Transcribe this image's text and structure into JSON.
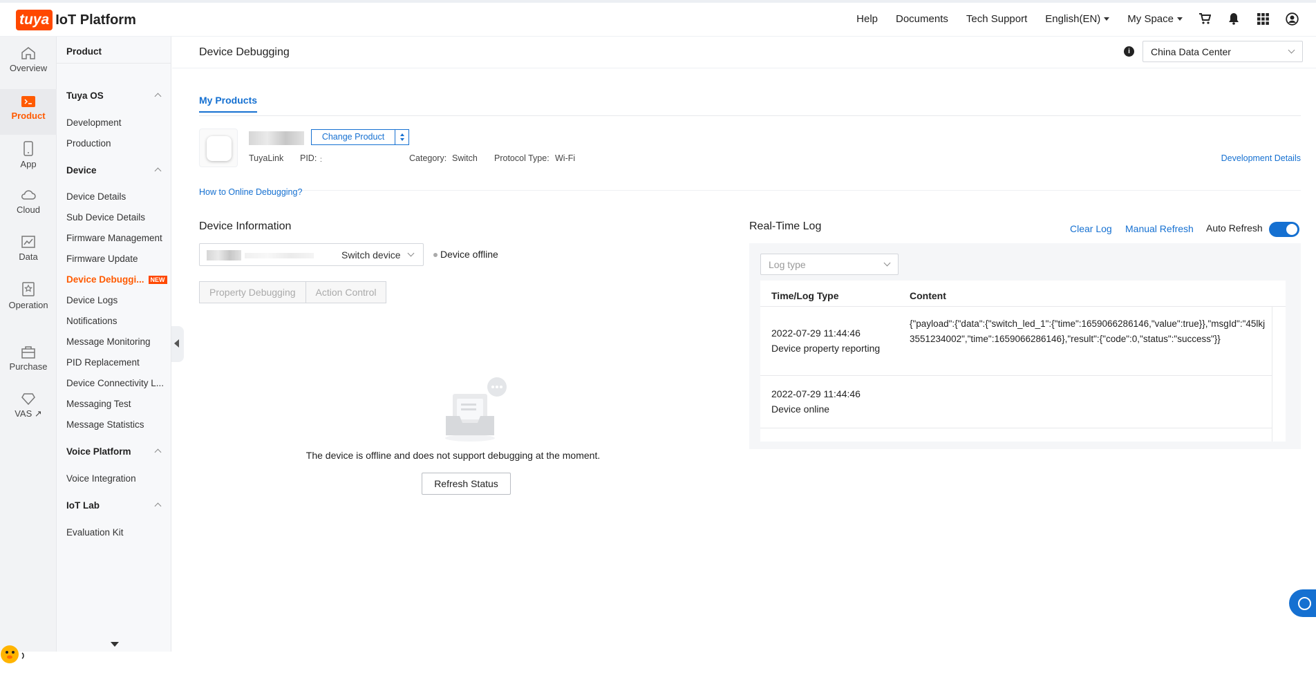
{
  "brand": {
    "logo_badge": "tuya",
    "logo_text": "IoT Platform"
  },
  "topnav": {
    "help": "Help",
    "documents": "Documents",
    "tech_support": "Tech Support",
    "language": "English(EN)",
    "my_space": "My Space"
  },
  "rail": {
    "items": [
      {
        "label": "Overview",
        "icon": "home-icon"
      },
      {
        "label": "Product",
        "icon": "terminal-icon"
      },
      {
        "label": "App",
        "icon": "phone-icon"
      },
      {
        "label": "Cloud",
        "icon": "cloud-icon"
      },
      {
        "label": "Data",
        "icon": "chart-icon"
      },
      {
        "label": "Operation",
        "icon": "badge-icon"
      },
      {
        "label": "Purchase",
        "icon": "bag-icon"
      },
      {
        "label": "VAS ↗",
        "icon": "diamond-icon"
      }
    ],
    "active_color": "#ff5a00"
  },
  "sidebar": {
    "title": "Product",
    "groups": {
      "tuya_os": "Tuya OS",
      "device": "Device",
      "voice": "Voice Platform",
      "iot_lab": "IoT Lab"
    },
    "items": {
      "development": "Development",
      "production": "Production",
      "device_details": "Device Details",
      "sub_device_details": "Sub Device Details",
      "firmware_management": "Firmware Management",
      "firmware_update": "Firmware Update",
      "device_debugging": "Device Debuggi...",
      "device_debugging_badge": "NEW",
      "device_logs": "Device Logs",
      "notifications": "Notifications",
      "message_monitoring": "Message Monitoring",
      "pid_replacement": "PID Replacement",
      "device_connectivity": "Device Connectivity L...",
      "messaging_test": "Messaging Test",
      "message_statistics": "Message Statistics",
      "voice_integration": "Voice Integration",
      "evaluation_kit": "Evaluation Kit"
    }
  },
  "page": {
    "title": "Device Debugging",
    "data_center": "China Data Center",
    "tab": "My Products",
    "product": {
      "change_button": "Change Product",
      "type": "TuyaLink",
      "pid_label": "PID:",
      "pid_value": ":",
      "category_label": "Category:",
      "category_value": "Switch",
      "protocol_label": "Protocol Type:",
      "protocol_value": "Wi-Fi",
      "dev_details": "Development Details"
    },
    "howto": "How to Online Debugging?"
  },
  "device_info": {
    "title": "Device Information",
    "select_label": "Switch device",
    "status": "Device offline",
    "tabs": [
      "Property Debugging",
      "Action Control"
    ],
    "empty_message": "The device is offline and does not support debugging at the moment.",
    "refresh_button": "Refresh Status"
  },
  "realtime_log": {
    "title": "Real-Time Log",
    "clear": "Clear Log",
    "manual_refresh": "Manual Refresh",
    "auto_refresh": "Auto Refresh",
    "auto_refresh_on": true,
    "log_type_placeholder": "Log type",
    "columns": [
      "Time/Log Type",
      "Content"
    ],
    "rows": [
      {
        "time": "2022-07-29 11:44:46",
        "type": "Device property reporting",
        "content": "{\"payload\":{\"data\":{\"switch_led_1\":{\"time\":1659066286146,\"value\":true}},\"msgId\":\"45lkj3551234002\",\"time\":1659066286146},\"result\":{\"code\":0,\"status\":\"success\"}}"
      },
      {
        "time": "2022-07-29 11:44:46",
        "type": "Device online",
        "content": ""
      }
    ]
  }
}
